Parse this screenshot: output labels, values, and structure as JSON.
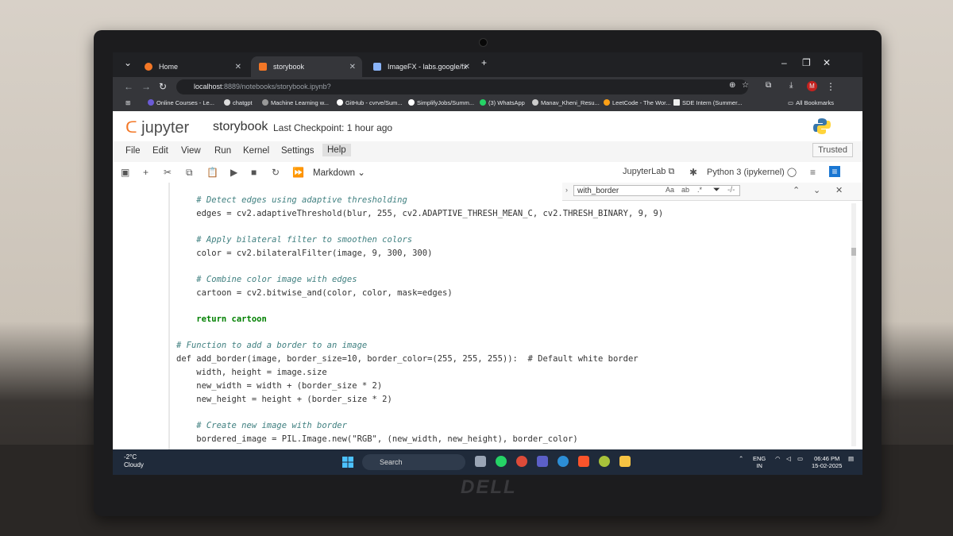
{
  "browser": {
    "tabs": [
      {
        "label": "Home",
        "active": false
      },
      {
        "label": "storybook",
        "active": true
      },
      {
        "label": "ImageFX - labs.google/fx",
        "active": false
      }
    ],
    "url_host": "localhost",
    "url_rest": ":8889/notebooks/storybook.ipynb?",
    "bookmarks": [
      "Online Courses - Le...",
      "chatgpt",
      "Machine Learning w...",
      "GitHub - cvrve/Sum...",
      "SimplifyJobs/Summ...",
      "(3) WhatsApp",
      "Manav_Kheni_Resu...",
      "LeetCode - The Wor...",
      "SDE Intern (Summer...",
      "All Bookmarks"
    ]
  },
  "jupyter": {
    "brand": "jupyter",
    "notebook_name": "storybook",
    "checkpoint": "Last Checkpoint: 1 hour ago",
    "menu": [
      "File",
      "Edit",
      "View",
      "Run",
      "Kernel",
      "Settings",
      "Help"
    ],
    "trusted": "Trusted",
    "cell_type": "Markdown",
    "jupyterlab_link": "JupyterLab",
    "kernel": "Python 3 (ipykernel)"
  },
  "find": {
    "query": "with_border",
    "result": "-/-"
  },
  "code_lines": [
    "    # Detect edges using adaptive thresholding",
    "    edges = cv2.adaptiveThreshold(blur, 255, cv2.ADAPTIVE_THRESH_MEAN_C, cv2.THRESH_BINARY, 9, 9)",
    "",
    "    # Apply bilateral filter to smoothen colors",
    "    color = cv2.bilateralFilter(image, 9, 300, 300)",
    "",
    "    # Combine color image with edges",
    "    cartoon = cv2.bitwise_and(color, color, mask=edges)",
    "",
    "    return cartoon",
    "",
    "# Function to add a border to an image",
    "def add_border(image, border_size=10, border_color=(255, 255, 255)):  # Default white border",
    "    width, height = image.size",
    "    new_width = width + (border_size * 2)",
    "    new_height = height + (border_size * 2)",
    "",
    "    # Create new image with border",
    "    bordered_image = PIL.Image.new(\"RGB\", (new_width, new_height), border_color)"
  ],
  "taskbar": {
    "weather_temp": "-2°C",
    "weather_desc": "Cloudy",
    "search": "Search",
    "lang1": "ENG",
    "lang2": "IN",
    "time": "06:46 PM",
    "date": "15-02-2025"
  },
  "colors": {
    "jupyter_orange": "#f37726",
    "chrome_dark": "#202124",
    "taskbar": "#1f2a3a"
  }
}
